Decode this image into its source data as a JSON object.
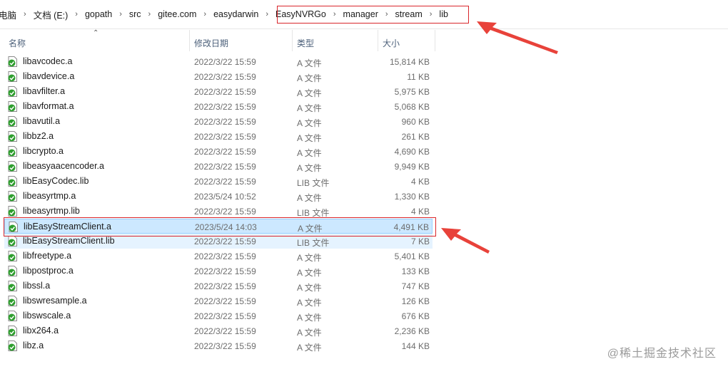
{
  "breadcrumb": {
    "items": [
      "电脑",
      "文档 (E:)",
      "gopath",
      "src",
      "gitee.com",
      "easydarwin",
      "EasyNVRGo",
      "manager",
      "stream",
      "lib"
    ],
    "separator": "›"
  },
  "columns": {
    "name": "名称",
    "date": "修改日期",
    "type": "类型",
    "size": "大小"
  },
  "files": [
    {
      "name": "libavcodec.a",
      "date": "2022/3/22 15:59",
      "type": "A 文件",
      "size": "15,814 KB"
    },
    {
      "name": "libavdevice.a",
      "date": "2022/3/22 15:59",
      "type": "A 文件",
      "size": "11 KB"
    },
    {
      "name": "libavfilter.a",
      "date": "2022/3/22 15:59",
      "type": "A 文件",
      "size": "5,975 KB"
    },
    {
      "name": "libavformat.a",
      "date": "2022/3/22 15:59",
      "type": "A 文件",
      "size": "5,068 KB"
    },
    {
      "name": "libavutil.a",
      "date": "2022/3/22 15:59",
      "type": "A 文件",
      "size": "960 KB"
    },
    {
      "name": "libbz2.a",
      "date": "2022/3/22 15:59",
      "type": "A 文件",
      "size": "261 KB"
    },
    {
      "name": "libcrypto.a",
      "date": "2022/3/22 15:59",
      "type": "A 文件",
      "size": "4,690 KB"
    },
    {
      "name": "libeasyaacencoder.a",
      "date": "2022/3/22 15:59",
      "type": "A 文件",
      "size": "9,949 KB"
    },
    {
      "name": "libEasyCodec.lib",
      "date": "2022/3/22 15:59",
      "type": "LIB 文件",
      "size": "4 KB"
    },
    {
      "name": "libeasyrtmp.a",
      "date": "2023/5/24 10:52",
      "type": "A 文件",
      "size": "1,330 KB"
    },
    {
      "name": "libeasyrtmp.lib",
      "date": "2022/3/22 15:59",
      "type": "LIB 文件",
      "size": "4 KB"
    },
    {
      "name": "libEasyStreamClient.a",
      "date": "2023/5/24 14:03",
      "type": "A 文件",
      "size": "4,491 KB"
    },
    {
      "name": "libEasyStreamClient.lib",
      "date": "2022/3/22 15:59",
      "type": "LIB 文件",
      "size": "7 KB"
    },
    {
      "name": "libfreetype.a",
      "date": "2022/3/22 15:59",
      "type": "A 文件",
      "size": "5,401 KB"
    },
    {
      "name": "libpostproc.a",
      "date": "2022/3/22 15:59",
      "type": "A 文件",
      "size": "133 KB"
    },
    {
      "name": "libssl.a",
      "date": "2022/3/22 15:59",
      "type": "A 文件",
      "size": "747 KB"
    },
    {
      "name": "libswresample.a",
      "date": "2022/3/22 15:59",
      "type": "A 文件",
      "size": "126 KB"
    },
    {
      "name": "libswscale.a",
      "date": "2022/3/22 15:59",
      "type": "A 文件",
      "size": "676 KB"
    },
    {
      "name": "libx264.a",
      "date": "2022/3/22 15:59",
      "type": "A 文件",
      "size": "2,236 KB"
    },
    {
      "name": "libz.a",
      "date": "2022/3/22 15:59",
      "type": "A 文件",
      "size": "144 KB"
    }
  ],
  "selected_file": "libEasyStreamClient.a",
  "hover_file": "libEasyStreamClient.lib",
  "watermark": "@稀土掘金技术社区",
  "colors": {
    "annotation_red": "#d9262b",
    "selection_bg": "#cce8ff",
    "hover_bg": "#e5f3ff",
    "icon_green": "#2f9e2f"
  },
  "icons": {
    "file": "file-check-icon",
    "sort": "sort-up-icon"
  }
}
